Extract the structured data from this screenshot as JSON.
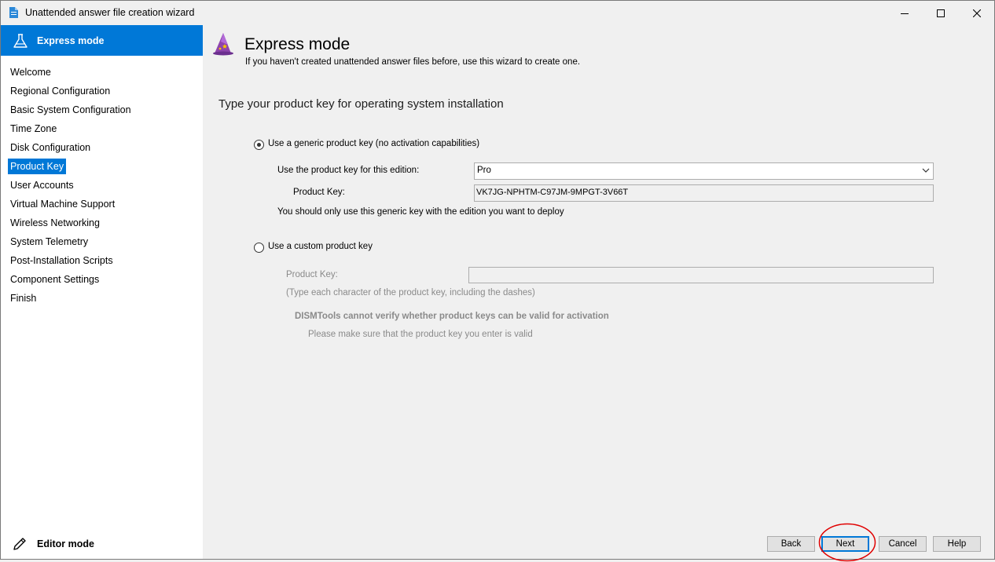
{
  "window": {
    "title": "Unattended answer file creation wizard",
    "accent_color": "#0078d7"
  },
  "sidebar": {
    "header_label": "Express mode",
    "items": [
      {
        "label": "Welcome"
      },
      {
        "label": "Regional Configuration"
      },
      {
        "label": "Basic System Configuration"
      },
      {
        "label": "Time Zone"
      },
      {
        "label": "Disk Configuration"
      },
      {
        "label": "Product Key",
        "active": true
      },
      {
        "label": "User Accounts"
      },
      {
        "label": "Virtual Machine Support"
      },
      {
        "label": "Wireless Networking"
      },
      {
        "label": "System Telemetry"
      },
      {
        "label": "Post-Installation Scripts"
      },
      {
        "label": "Component Settings"
      },
      {
        "label": "Finish"
      }
    ],
    "footer_label": "Editor mode"
  },
  "main": {
    "heading": "Express mode",
    "subheading": "If you haven't created unattended answer files before, use this wizard to create one.",
    "section_title": "Type your product key for operating system installation",
    "generic": {
      "radio_label": "Use a generic product key (no activation capabilities)",
      "selected": true,
      "edition_label": "Use the product key for this edition:",
      "edition_value": "Pro",
      "key_label": "Product Key:",
      "key_value": "VK7JG-NPHTM-C97JM-9MPGT-3V66T",
      "note": "You should only use this generic key with the edition you want to deploy"
    },
    "custom": {
      "radio_label": "Use a custom product key",
      "selected": false,
      "key_label": "Product Key:",
      "key_value": "",
      "hint": "(Type each character of the product key, including the dashes)",
      "warning_title": "DISMTools cannot verify whether product keys can be valid for activation",
      "warning_text": "Please make sure that the product key you enter is valid"
    }
  },
  "buttons": {
    "back": "Back",
    "next": "Next",
    "cancel": "Cancel",
    "help": "Help"
  },
  "annotation_color": "#e00000"
}
